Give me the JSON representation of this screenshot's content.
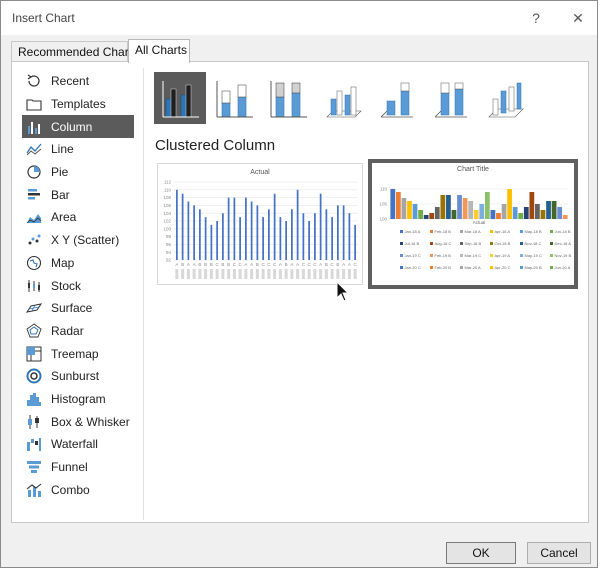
{
  "window": {
    "title": "Insert Chart",
    "help_icon": "?",
    "close_icon": "✕"
  },
  "tabs": [
    {
      "label": "Recommended Charts"
    },
    {
      "label": "All Charts"
    }
  ],
  "chart_types": [
    {
      "label": "Recent",
      "icon": "recent-icon"
    },
    {
      "label": "Templates",
      "icon": "templates-icon"
    },
    {
      "label": "Column",
      "icon": "column-chart-icon"
    },
    {
      "label": "Line",
      "icon": "line-chart-icon"
    },
    {
      "label": "Pie",
      "icon": "pie-chart-icon"
    },
    {
      "label": "Bar",
      "icon": "bar-chart-icon"
    },
    {
      "label": "Area",
      "icon": "area-chart-icon"
    },
    {
      "label": "X Y (Scatter)",
      "icon": "scatter-chart-icon"
    },
    {
      "label": "Map",
      "icon": "map-chart-icon"
    },
    {
      "label": "Stock",
      "icon": "stock-chart-icon"
    },
    {
      "label": "Surface",
      "icon": "surface-chart-icon"
    },
    {
      "label": "Radar",
      "icon": "radar-chart-icon"
    },
    {
      "label": "Treemap",
      "icon": "treemap-chart-icon"
    },
    {
      "label": "Sunburst",
      "icon": "sunburst-chart-icon"
    },
    {
      "label": "Histogram",
      "icon": "histogram-chart-icon"
    },
    {
      "label": "Box & Whisker",
      "icon": "box-whisker-chart-icon"
    },
    {
      "label": "Waterfall",
      "icon": "waterfall-chart-icon"
    },
    {
      "label": "Funnel",
      "icon": "funnel-chart-icon"
    },
    {
      "label": "Combo",
      "icon": "combo-chart-icon"
    }
  ],
  "selected_type": "Column",
  "selected_subtype": "Clustered Column",
  "previews": [
    {
      "title": "Actual"
    },
    {
      "title": "Chart Title"
    }
  ],
  "buttons": {
    "ok": "OK",
    "cancel": "Cancel"
  },
  "colors": {
    "selection": "#5b5b5b",
    "bar_blue": "#4472c4"
  },
  "chart_data": [
    {
      "type": "bar",
      "title": "Actual",
      "ylim": [
        92,
        112
      ],
      "yticks": [
        112,
        110,
        108,
        106,
        104,
        102,
        100,
        98,
        96,
        94,
        92
      ],
      "categories": [
        "A",
        "B",
        "A",
        "A",
        "B",
        "B",
        "B",
        "C",
        "B",
        "B",
        "C",
        "C",
        "A",
        "A",
        "B",
        "C",
        "C",
        "C",
        "A",
        "B",
        "A",
        "A",
        "C",
        "C",
        "C",
        "A",
        "B",
        "C",
        "B",
        "A",
        "A",
        "C"
      ],
      "values": [
        110,
        109,
        107,
        106,
        105,
        103,
        101,
        102,
        104,
        108,
        108,
        103,
        108,
        107,
        106,
        103,
        105,
        109,
        103,
        102,
        105,
        110,
        104,
        102,
        104,
        109,
        105,
        103,
        106,
        106,
        104,
        101
      ]
    },
    {
      "type": "bar",
      "title": "Chart Title",
      "xlabel": "Actual",
      "ylim": [
        100,
        112
      ],
      "yticks": [
        110,
        105,
        100
      ],
      "legend": [
        "Jan-18 A",
        "Feb-18 B",
        "Mar-18 A",
        "Apr-18 A",
        "May-18 B",
        "Jun-18 B",
        "Jul-18 B",
        "Aug-18 C",
        "Sep-18 B",
        "Oct-18 B",
        "Nov-18 C",
        "Dec-18 A",
        "Jan-19 C",
        "Feb-19 B",
        "Mar-19 C",
        "Apr-19 A",
        "May-19 C",
        "Nov-19 B",
        "Jan-20 C",
        "Feb-20 B",
        "Mar-20 A",
        "Apr-20 C",
        "May-20 B",
        "Jun-20 A"
      ],
      "values": [
        110,
        109,
        107,
        106,
        105,
        103,
        101,
        102,
        104,
        108,
        108,
        103,
        108,
        107,
        106,
        103,
        105,
        109,
        103,
        102,
        105,
        110,
        104,
        102,
        104,
        109,
        105,
        103,
        106,
        106,
        104,
        101
      ]
    }
  ]
}
